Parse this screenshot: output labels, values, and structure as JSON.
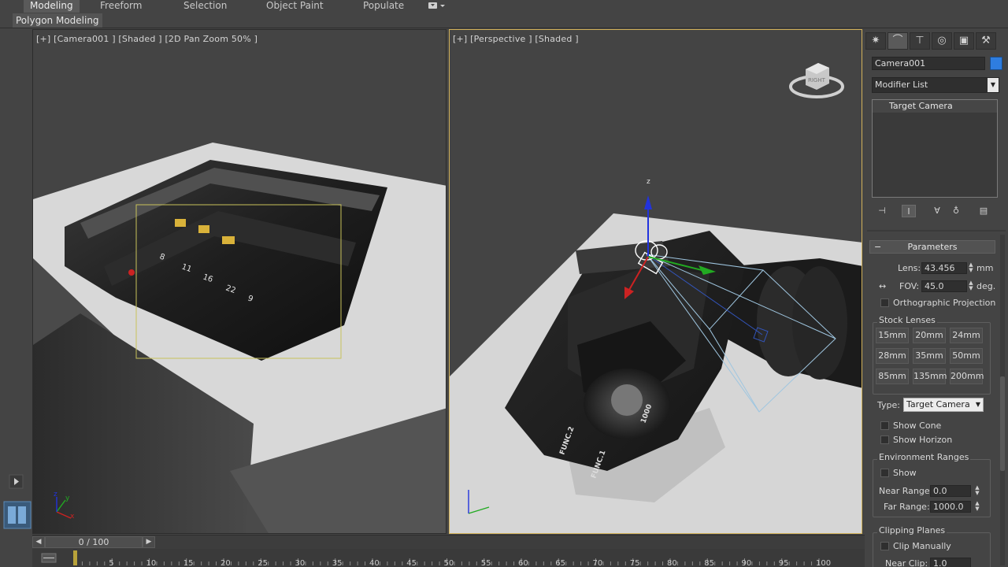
{
  "ribbon": {
    "tabs": [
      "Modeling",
      "Freeform",
      "Selection",
      "Object Paint",
      "Populate"
    ],
    "active_tab": "Modeling",
    "group_label": "Polygon Modeling",
    "extra_icon": "ribbon-options-icon"
  },
  "viewports": {
    "left_label": "[+] [Camera001 ] [Shaded ] [2D Pan Zoom 50% ]",
    "right_label": "[+] [Perspective ] [Shaded ]",
    "lens_marks": [
      "8",
      "11",
      "16",
      "22",
      "9"
    ],
    "gizmo_axes": {
      "x": "x",
      "y": "y",
      "z": "z"
    },
    "viewcube_face": "RIGHT",
    "dial_marks": [
      "FUNC.1",
      "FUNC.2",
      "1000"
    ]
  },
  "command_panel": {
    "tab_icons": [
      "create-icon",
      "modify-icon",
      "hierarchy-icon",
      "motion-icon",
      "display-icon",
      "utilities-icon"
    ],
    "object_name": "Camera001",
    "object_color": "#2e7de0",
    "modifier_list": "Modifier List",
    "stack_items": [
      "Target Camera"
    ],
    "rollout_title": "Parameters",
    "lens_label": "Lens:",
    "lens_value": "43.456",
    "lens_unit": "mm",
    "fov_label": "FOV:",
    "fov_value": "45.0",
    "fov_unit": "deg.",
    "ortho_label": "Orthographic Projection",
    "stock_lenses_title": "Stock Lenses",
    "stock_lenses": [
      "15mm",
      "20mm",
      "24mm",
      "28mm",
      "35mm",
      "50mm",
      "85mm",
      "135mm",
      "200mm"
    ],
    "type_label": "Type:",
    "type_value": "Target Camera",
    "show_cone": "Show Cone",
    "show_horizon": "Show Horizon",
    "env_title": "Environment Ranges",
    "env_show": "Show",
    "near_range_label": "Near Range:",
    "near_range_value": "0.0",
    "far_range_label": "Far Range:",
    "far_range_value": "1000.0",
    "clip_title": "Clipping Planes",
    "clip_manually": "Clip Manually",
    "near_clip_label": "Near Clip:",
    "near_clip_value": "1.0"
  },
  "timeline": {
    "slider_text": "0 / 100",
    "ticks": [
      5,
      10,
      15,
      20,
      25,
      30,
      35,
      40,
      45,
      50,
      55,
      60,
      65,
      70,
      75,
      80,
      85,
      90,
      95,
      100
    ],
    "start": 0,
    "end": 100,
    "current": 0
  },
  "colors": {
    "active_viewport_border": "#d3b25a",
    "axis_x": "#cc2222",
    "axis_y": "#22aa22",
    "axis_z": "#2233dd"
  }
}
